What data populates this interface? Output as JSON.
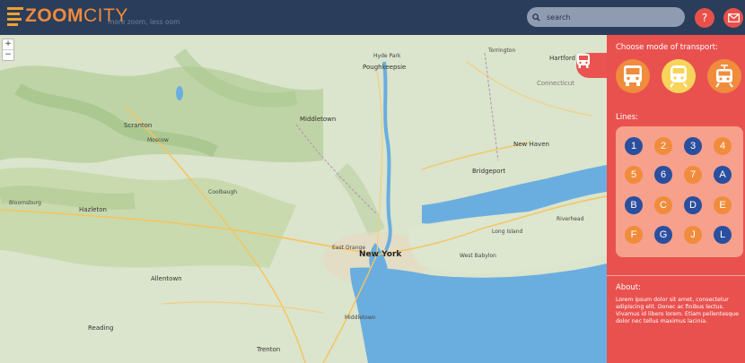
{
  "app": {
    "logo_text": "ZOOM",
    "logo_text_city": "CITY",
    "tagline": "more zoom, less oom"
  },
  "search": {
    "placeholder": "search",
    "value": ""
  },
  "header_buttons": {
    "help": "?",
    "mail_icon": "mail-icon"
  },
  "map": {
    "zoom_in": "+",
    "zoom_out": "−",
    "places": [
      {
        "name": "Hartford",
        "cls": "big"
      },
      {
        "name": "Torrington",
        "cls": ""
      },
      {
        "name": "Connecticut",
        "cls": "big"
      },
      {
        "name": "Poughkeepsie",
        "cls": "big"
      },
      {
        "name": "Hyde Park",
        "cls": ""
      },
      {
        "name": "Scranton",
        "cls": "big"
      },
      {
        "name": "Moscow",
        "cls": ""
      },
      {
        "name": "Middletown",
        "cls": "big"
      },
      {
        "name": "New Haven",
        "cls": "big"
      },
      {
        "name": "Bridgeport",
        "cls": "big"
      },
      {
        "name": "Coolbaugh",
        "cls": ""
      },
      {
        "name": "Bloomsburg",
        "cls": ""
      },
      {
        "name": "Hazleton",
        "cls": "big"
      },
      {
        "name": "Riverhead",
        "cls": ""
      },
      {
        "name": "Long Island",
        "cls": ""
      },
      {
        "name": "East Orange",
        "cls": ""
      },
      {
        "name": "New York",
        "cls": "city"
      },
      {
        "name": "West Babylon",
        "cls": ""
      },
      {
        "name": "Allentown",
        "cls": "big"
      },
      {
        "name": "Reading",
        "cls": "big"
      },
      {
        "name": "Middletown",
        "cls": ""
      },
      {
        "name": "Trenton",
        "cls": "big"
      }
    ]
  },
  "panel": {
    "transport_heading": "Choose mode of transport:",
    "transport_modes": [
      {
        "name": "bus",
        "icon": "bus-icon",
        "color": "#f08c3c"
      },
      {
        "name": "train",
        "icon": "train-icon",
        "color": "#f7d45a"
      },
      {
        "name": "tram",
        "icon": "tram-icon",
        "color": "#f08c3c"
      }
    ],
    "lines_heading": "Lines:",
    "lines": [
      {
        "label": "1",
        "color": "blue"
      },
      {
        "label": "2",
        "color": "orange"
      },
      {
        "label": "3",
        "color": "blue"
      },
      {
        "label": "4",
        "color": "orange"
      },
      {
        "label": "5",
        "color": "orange"
      },
      {
        "label": "6",
        "color": "blue"
      },
      {
        "label": "7",
        "color": "orange"
      },
      {
        "label": "A",
        "color": "blue"
      },
      {
        "label": "B",
        "color": "blue"
      },
      {
        "label": "C",
        "color": "orange"
      },
      {
        "label": "D",
        "color": "blue"
      },
      {
        "label": "E",
        "color": "orange"
      },
      {
        "label": "F",
        "color": "orange"
      },
      {
        "label": "G",
        "color": "blue"
      },
      {
        "label": "J",
        "color": "orange"
      },
      {
        "label": "L",
        "color": "blue"
      }
    ],
    "about_heading": "About:",
    "about_text": "Lorem ipsum dolor sit amet, consectetur adipiscing elit. Donec ac finibus lectus. Vivamus id libero lorem. Etiam pellentesque dolor nec tellus maximus lacinia."
  },
  "colors": {
    "header_bg": "#2a3d5a",
    "panel_bg": "#e9514f",
    "accent_orange": "#f08c3c",
    "line_blue": "#2a4f9e",
    "water": "#6aaee0"
  }
}
